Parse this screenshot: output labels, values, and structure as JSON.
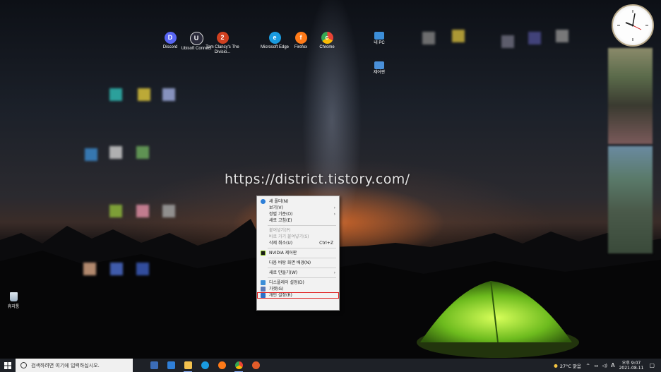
{
  "watermark": "https://district.tistory.com/",
  "desktop_icons": [
    {
      "label": "Discord",
      "icon": "discord-icon",
      "color": "#5865F2",
      "glyph": "D"
    },
    {
      "label": "Ubisoft Connect",
      "icon": "ubisoft-icon",
      "color": "#2a2a3a",
      "glyph": "U"
    },
    {
      "label": "Tom Clancy's The Divisio...",
      "icon": "division2-icon",
      "color": "#d04020",
      "glyph": "2"
    },
    {
      "label": "Microsoft Edge",
      "icon": "edge-icon",
      "color": "#1a9be0",
      "glyph": "e"
    },
    {
      "label": "Firefox",
      "icon": "firefox-icon",
      "color": "#ff7a18",
      "glyph": "f"
    },
    {
      "label": "Chrome",
      "icon": "chrome-icon",
      "color": "#34a853",
      "glyph": "c"
    },
    {
      "label": "내 PC",
      "icon": "this-pc-icon",
      "color": "#3c8ed8",
      "glyph": ""
    },
    {
      "label": "제어판",
      "icon": "control-panel-icon",
      "color": "#4a90d9",
      "glyph": ""
    }
  ],
  "recycle_bin": {
    "label": "휴지통",
    "icon": "recycle-bin-icon"
  },
  "context_menu": {
    "items": [
      {
        "label": "새 폴더(N)",
        "icon": "new-folder-icon",
        "enabled": true,
        "submenu": false
      },
      {
        "label": "보기(V)",
        "enabled": true,
        "submenu": true
      },
      {
        "label": "정렬 기준(O)",
        "enabled": true,
        "submenu": true
      },
      {
        "label": "새로 고침(E)",
        "enabled": true,
        "submenu": false
      },
      {
        "label": "붙여넣기(P)",
        "enabled": false,
        "submenu": false
      },
      {
        "label": "바로 가기 붙여넣기(S)",
        "enabled": false,
        "submenu": false
      },
      {
        "label": "삭제 취소(U)",
        "enabled": true,
        "submenu": false,
        "shortcut": "Ctrl+Z"
      },
      {
        "label": "NVIDIA 제어판",
        "icon": "nvidia-icon",
        "enabled": true,
        "submenu": false
      },
      {
        "label": "다음 바탕 화면 배경(N)",
        "enabled": true,
        "submenu": false
      },
      {
        "label": "새로 만들기(W)",
        "enabled": true,
        "submenu": true
      },
      {
        "label": "디스플레이 설정(D)",
        "icon": "display-icon",
        "enabled": true,
        "submenu": false
      },
      {
        "label": "가젯(G)",
        "icon": "gadget-icon",
        "enabled": true,
        "submenu": false
      },
      {
        "label": "개인 설정(R)",
        "icon": "personalize-icon",
        "enabled": true,
        "submenu": false,
        "highlighted": true
      }
    ]
  },
  "taskbar": {
    "search_placeholder": "검색하려면 여기에 입력하십시오.",
    "apps": [
      {
        "name": "store-icon",
        "color": "#3b6cb7"
      },
      {
        "name": "mail-icon",
        "color": "#2f7fd8"
      },
      {
        "name": "file-explorer-icon",
        "color": "#f2c14e"
      },
      {
        "name": "edge-icon",
        "color": "#1a9be0"
      },
      {
        "name": "firefox-icon",
        "color": "#ff7a18"
      },
      {
        "name": "chrome-icon",
        "color": "#e8453c"
      },
      {
        "name": "firefox-icon",
        "color": "#e25c2a"
      }
    ],
    "weather": "27°C 맑음",
    "ime": "A",
    "time": "오후 9:07",
    "date": "2021-08-11"
  }
}
